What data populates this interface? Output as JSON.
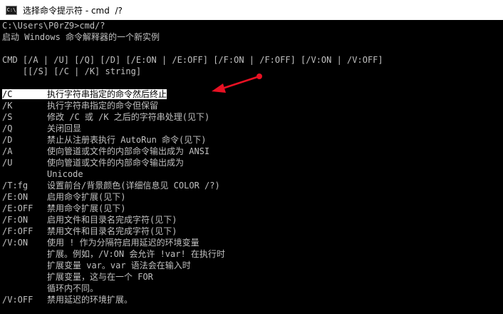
{
  "window": {
    "title": "选择命令提示符 - cmd  /?",
    "icon": "cmd-icon",
    "icon_glyph": "C:\\"
  },
  "console": {
    "prompt": "C:\\Users\\P0rZ9>cmd/?",
    "description": "启动 Windows 命令解释器的一个新实例",
    "blank1": "",
    "usage1": "CMD [/A | /U] [/Q] [/D] [/E:ON | /E:OFF] [/F:ON | /F:OFF] [/V:ON | /V:OFF]",
    "usage2": "    [[/S] [/C | /K] string]",
    "blank2": "",
    "options": [
      {
        "flag": "/C",
        "text": "执行字符串指定的命令然后终止"
      },
      {
        "flag": "/K",
        "text": "执行字符串指定的命令但保留"
      },
      {
        "flag": "/S",
        "text": "修改 /C 或 /K 之后的字符串处理(见下)"
      },
      {
        "flag": "/Q",
        "text": "关闭回显"
      },
      {
        "flag": "/D",
        "text": "禁止从注册表执行 AutoRun 命令(见下)"
      },
      {
        "flag": "/A",
        "text": "使向管道或文件的内部命令输出成为 ANSI"
      },
      {
        "flag": "/U",
        "text": "使向管道或文件的内部命令输出成为"
      },
      {
        "flag": "",
        "text": "Unicode"
      },
      {
        "flag": "/T:fg",
        "text": "设置前台/背景颜色(详细信息见 COLOR /?)"
      },
      {
        "flag": "/E:ON",
        "text": "启用命令扩展(见下)"
      },
      {
        "flag": "/E:OFF",
        "text": "禁用命令扩展(见下)"
      },
      {
        "flag": "/F:ON",
        "text": "启用文件和目录名完成字符(见下)"
      },
      {
        "flag": "/F:OFF",
        "text": "禁用文件和目录名完成字符(见下)"
      },
      {
        "flag": "/V:ON",
        "text": "使用 ! 作为分隔符启用延迟的环境变量"
      },
      {
        "flag": "",
        "text": "扩展。例如，/V:ON 会允许 !var! 在执行时"
      },
      {
        "flag": "",
        "text": "扩展变量 var。var 语法会在输入时"
      },
      {
        "flag": "",
        "text": "扩展变量，这与在一个 FOR"
      },
      {
        "flag": "",
        "text": "循环内不同。"
      },
      {
        "flag": "/V:OFF",
        "text": "禁用延迟的环境扩展。"
      }
    ]
  },
  "colors": {
    "console_bg": "#000000",
    "console_fg": "#c0c0c0",
    "highlight_bg": "#ffffff",
    "highlight_fg": "#000000",
    "annotation": "#e81123"
  },
  "annotation": {
    "type": "arrow",
    "target": "option-/C"
  }
}
